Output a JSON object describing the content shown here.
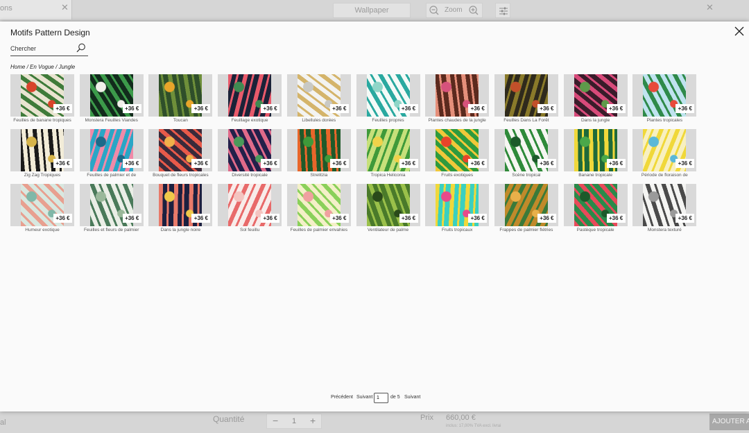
{
  "background": {
    "tab_label": "ons",
    "wallpaper_label": "Wallpaper",
    "zoom_label": "Zoom",
    "bottom_left_label": "al",
    "quantity_label": "Quantité",
    "quantity_value": "1",
    "price_label": "Prix",
    "price_value": "660,00 €",
    "price_note": "inclus: 17,00% TVA excl. livrai",
    "add_button_label": "AJOUTER AU"
  },
  "modal": {
    "title": "Motifs Pattern Design",
    "search_placeholder": "Chercher",
    "breadcrumb": [
      "Home",
      "En Vogue",
      "Jungle"
    ]
  },
  "patterns": [
    {
      "name": "Feuilles de banane tropiques",
      "price": "+36 €",
      "colors": [
        "#e9e4d0",
        "#3f7b3a",
        "#d8442a"
      ]
    },
    {
      "name": "Monstera Feuilles Viandes",
      "price": "+36 €",
      "colors": [
        "#122b1c",
        "#3c9a4a",
        "#f1f1ea"
      ]
    },
    {
      "name": "Toucan",
      "price": "+36 €",
      "colors": [
        "#2f4f2a",
        "#6e8f3a",
        "#e8a52a"
      ]
    },
    {
      "name": "Feuillage exotique",
      "price": "+36 €",
      "colors": [
        "#1b2238",
        "#e85a6b",
        "#3f8b52"
      ]
    },
    {
      "name": "Libellules dorées",
      "price": "+36 €",
      "colors": [
        "#f3f3f1",
        "#d4b46a",
        "#c9c9c4"
      ]
    },
    {
      "name": "Feuilles propres",
      "price": "+36 €",
      "colors": [
        "#f4faf7",
        "#2aa9a0",
        "#8fd6c8"
      ]
    },
    {
      "name": "Plantes chaudes de la jungle",
      "price": "+36 €",
      "colors": [
        "#5b2a1e",
        "#e58f7a",
        "#d6527c"
      ]
    },
    {
      "name": "Feuilles Dans La Forêt",
      "price": "+36 €",
      "colors": [
        "#2f2a1c",
        "#8a7a2a",
        "#c2502a"
      ]
    },
    {
      "name": "Dans la jungle",
      "price": "+36 €",
      "colors": [
        "#3a1c2a",
        "#d84a7a",
        "#5e9a4a"
      ]
    },
    {
      "name": "Plantes tropicales",
      "price": "+36 €",
      "colors": [
        "#bfe3ef",
        "#2f8a4a",
        "#e84a3a"
      ]
    },
    {
      "name": "Zig Zag Tropiques",
      "price": "+36 €",
      "colors": [
        "#f2ecd8",
        "#1a1a1a",
        "#d6b44a"
      ]
    },
    {
      "name": "Feuilles de palmier et de",
      "price": "+36 €",
      "colors": [
        "#2aa6c6",
        "#f08aa8",
        "#1c6a8a"
      ]
    },
    {
      "name": "Bouquet de fleurs tropicales",
      "price": "+36 €",
      "colors": [
        "#3a2a3a",
        "#e85a4a",
        "#f0b04a"
      ]
    },
    {
      "name": "Diversité tropicale",
      "price": "+36 €",
      "colors": [
        "#23204a",
        "#e06a8a",
        "#4a9a5a"
      ]
    },
    {
      "name": "Strelitzia",
      "price": "+36 €",
      "colors": [
        "#1f5a2a",
        "#e8662a",
        "#3f9a3a"
      ]
    },
    {
      "name": "Tropica Heliconia",
      "price": "+36 €",
      "colors": [
        "#c6e07a",
        "#3f9a3a",
        "#f0d24a"
      ]
    },
    {
      "name": "Fruits exotiques",
      "price": "+36 €",
      "colors": [
        "#2e9a3e",
        "#f0c83a",
        "#e8442a"
      ]
    },
    {
      "name": "Scène tropical",
      "price": "+36 €",
      "colors": [
        "#f6f6f2",
        "#2f8a3a",
        "#1c5a2a"
      ]
    },
    {
      "name": "Banane tropicale",
      "price": "+36 €",
      "colors": [
        "#1f6a3a",
        "#f0d83a",
        "#4aa84a"
      ]
    },
    {
      "name": "Période de floraison de",
      "price": "+36 €",
      "colors": [
        "#f8f0c0",
        "#f0d83a",
        "#5ab8d8"
      ]
    },
    {
      "name": "Humeur exotique",
      "price": "+36 €",
      "colors": [
        "#d8e8e0",
        "#e8a090",
        "#7fb8a8"
      ]
    },
    {
      "name": "Feuilles et fleurs de palmier",
      "price": "+36 €",
      "colors": [
        "#eaeee6",
        "#4a7a5a",
        "#9ab89a"
      ]
    },
    {
      "name": "Dans la jungle noire",
      "price": "+36 €",
      "colors": [
        "#1c2040",
        "#e87a6a",
        "#f0c84a"
      ]
    },
    {
      "name": "Sol feuillu",
      "price": "+36 €",
      "colors": [
        "#f8ecea",
        "#e86a6a",
        "#f4c4c0"
      ]
    },
    {
      "name": "Feuilles de palmier envahies",
      "price": "+36 €",
      "colors": [
        "#f4f0c8",
        "#8ad05a",
        "#f0a0a0"
      ]
    },
    {
      "name": "Ventilateur de palme",
      "price": "+36 €",
      "colors": [
        "#4a7a2a",
        "#9ac04a",
        "#2a4a1a"
      ]
    },
    {
      "name": "Fruits tropicaux",
      "price": "+36 €",
      "colors": [
        "#3ad0c0",
        "#f0d83a",
        "#e84a8a"
      ]
    },
    {
      "name": "Frappes de palmier flétries",
      "price": "+36 €",
      "colors": [
        "#c08a2a",
        "#3a7a3a",
        "#e8b04a"
      ]
    },
    {
      "name": "Pastèque tropicale",
      "price": "+36 €",
      "colors": [
        "#2a8a4a",
        "#e84a5a",
        "#1c5a2a"
      ]
    },
    {
      "name": "Monstera texturé",
      "price": "+36 €",
      "colors": [
        "#f4f4f2",
        "#4a4a4a",
        "#9a9a9a"
      ]
    }
  ],
  "pagination": {
    "prev_label": "Précédent",
    "next_label": "Suivant",
    "page_value": "1",
    "of_label": "de 5",
    "next_label_2": "Suivant"
  }
}
